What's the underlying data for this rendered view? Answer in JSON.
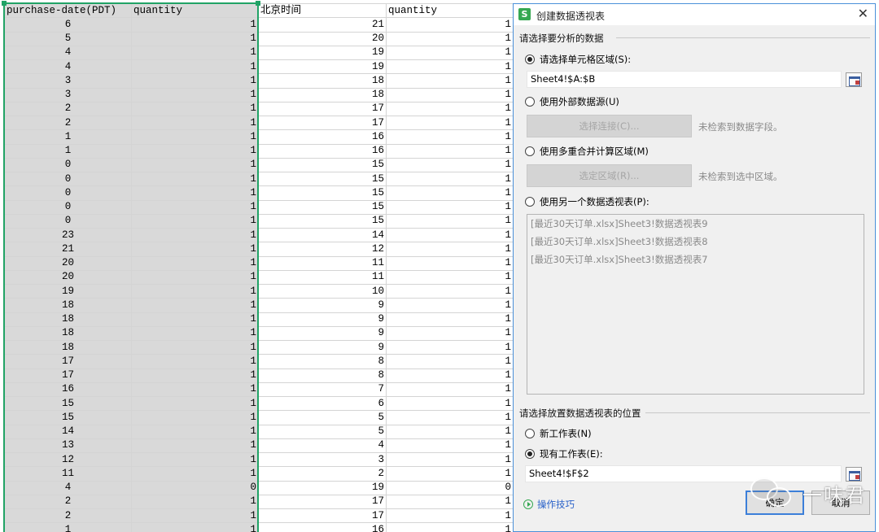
{
  "sheet": {
    "headers": [
      "purchase-date(PDT)",
      "quantity",
      "北京时间",
      "quantity"
    ],
    "rows": [
      [
        "6",
        "1",
        "21",
        "1"
      ],
      [
        "5",
        "1",
        "20",
        "1"
      ],
      [
        "4",
        "1",
        "19",
        "1"
      ],
      [
        "4",
        "1",
        "19",
        "1"
      ],
      [
        "3",
        "1",
        "18",
        "1"
      ],
      [
        "3",
        "1",
        "18",
        "1"
      ],
      [
        "2",
        "1",
        "17",
        "1"
      ],
      [
        "2",
        "1",
        "17",
        "1"
      ],
      [
        "1",
        "1",
        "16",
        "1"
      ],
      [
        "1",
        "1",
        "16",
        "1"
      ],
      [
        "0",
        "1",
        "15",
        "1"
      ],
      [
        "0",
        "1",
        "15",
        "1"
      ],
      [
        "0",
        "1",
        "15",
        "1"
      ],
      [
        "0",
        "1",
        "15",
        "1"
      ],
      [
        "0",
        "1",
        "15",
        "1"
      ],
      [
        "23",
        "1",
        "14",
        "1"
      ],
      [
        "21",
        "1",
        "12",
        "1"
      ],
      [
        "20",
        "1",
        "11",
        "1"
      ],
      [
        "20",
        "1",
        "11",
        "1"
      ],
      [
        "19",
        "1",
        "10",
        "1"
      ],
      [
        "18",
        "1",
        "9",
        "1"
      ],
      [
        "18",
        "1",
        "9",
        "1"
      ],
      [
        "18",
        "1",
        "9",
        "1"
      ],
      [
        "18",
        "1",
        "9",
        "1"
      ],
      [
        "17",
        "1",
        "8",
        "1"
      ],
      [
        "17",
        "1",
        "8",
        "1"
      ],
      [
        "16",
        "1",
        "7",
        "1"
      ],
      [
        "15",
        "1",
        "6",
        "1"
      ],
      [
        "15",
        "1",
        "5",
        "1"
      ],
      [
        "14",
        "1",
        "5",
        "1"
      ],
      [
        "13",
        "1",
        "4",
        "1"
      ],
      [
        "12",
        "1",
        "3",
        "1"
      ],
      [
        "11",
        "1",
        "2",
        "1"
      ],
      [
        "4",
        "0",
        "19",
        "0"
      ],
      [
        "2",
        "1",
        "17",
        "1"
      ],
      [
        "2",
        "1",
        "17",
        "1"
      ],
      [
        "1",
        "1",
        "16",
        "1"
      ]
    ]
  },
  "dialog": {
    "app_icon": "S",
    "title": "创建数据透视表",
    "close_glyph": "✕",
    "section_source": "请选择要分析的数据",
    "opt_range": "请选择单元格区域(S):",
    "range_value": "Sheet4!$A:$B",
    "opt_external": "使用外部数据源(U)",
    "btn_connect": "选择连接(C)...",
    "hint_connect": "未检索到数据字段。",
    "opt_multi": "使用多重合并计算区域(M)",
    "btn_region": "选定区域(R)...",
    "hint_region": "未检索到选中区域。",
    "opt_other": "使用另一个数据透视表(P):",
    "pivot_list": [
      "[最近30天订单.xlsx]Sheet3!数据透视表9",
      "[最近30天订单.xlsx]Sheet3!数据透视表8",
      "[最近30天订单.xlsx]Sheet3!数据透视表7"
    ],
    "section_dest": "请选择放置数据透视表的位置",
    "opt_new": "新工作表(N)",
    "opt_existing": "现有工作表(E):",
    "dest_value": "Sheet4!$F$2",
    "tips": "操作技巧",
    "ok": "确定",
    "cancel": "取消"
  },
  "watermark": {
    "text": "一味君"
  },
  "colors": {
    "accent": "#4a90d9",
    "selection": "#21a366",
    "app_green": "#36a852",
    "link": "#2a62c9"
  }
}
